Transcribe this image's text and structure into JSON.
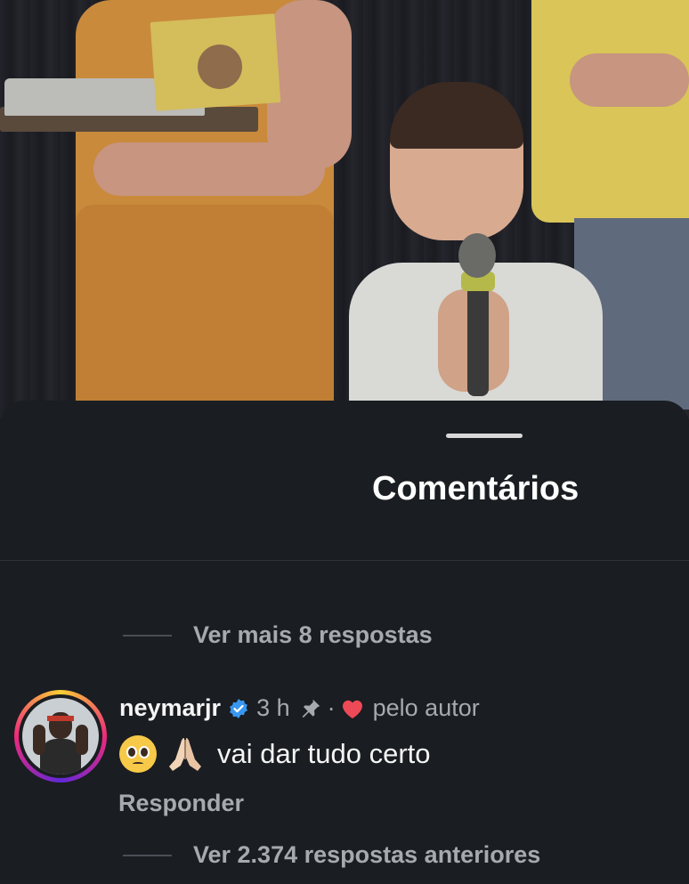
{
  "sheet": {
    "title": "Comentários"
  },
  "replies": {
    "more_label": "Ver mais 8 respostas",
    "previous_label": "Ver 2.374 respostas anteriores"
  },
  "comment": {
    "username": "neymarjr",
    "time": "3 h",
    "separator": "·",
    "liked_by_author_label": "pelo autor",
    "text": "vai dar tudo certo",
    "emojis": [
      "pleading-face",
      "folded-hands"
    ],
    "reply_label": "Responder"
  },
  "colors": {
    "background": "#1a1d21",
    "verified": "#3897f0",
    "heart": "#ed4956",
    "muted_text": "#a6a9ae"
  }
}
